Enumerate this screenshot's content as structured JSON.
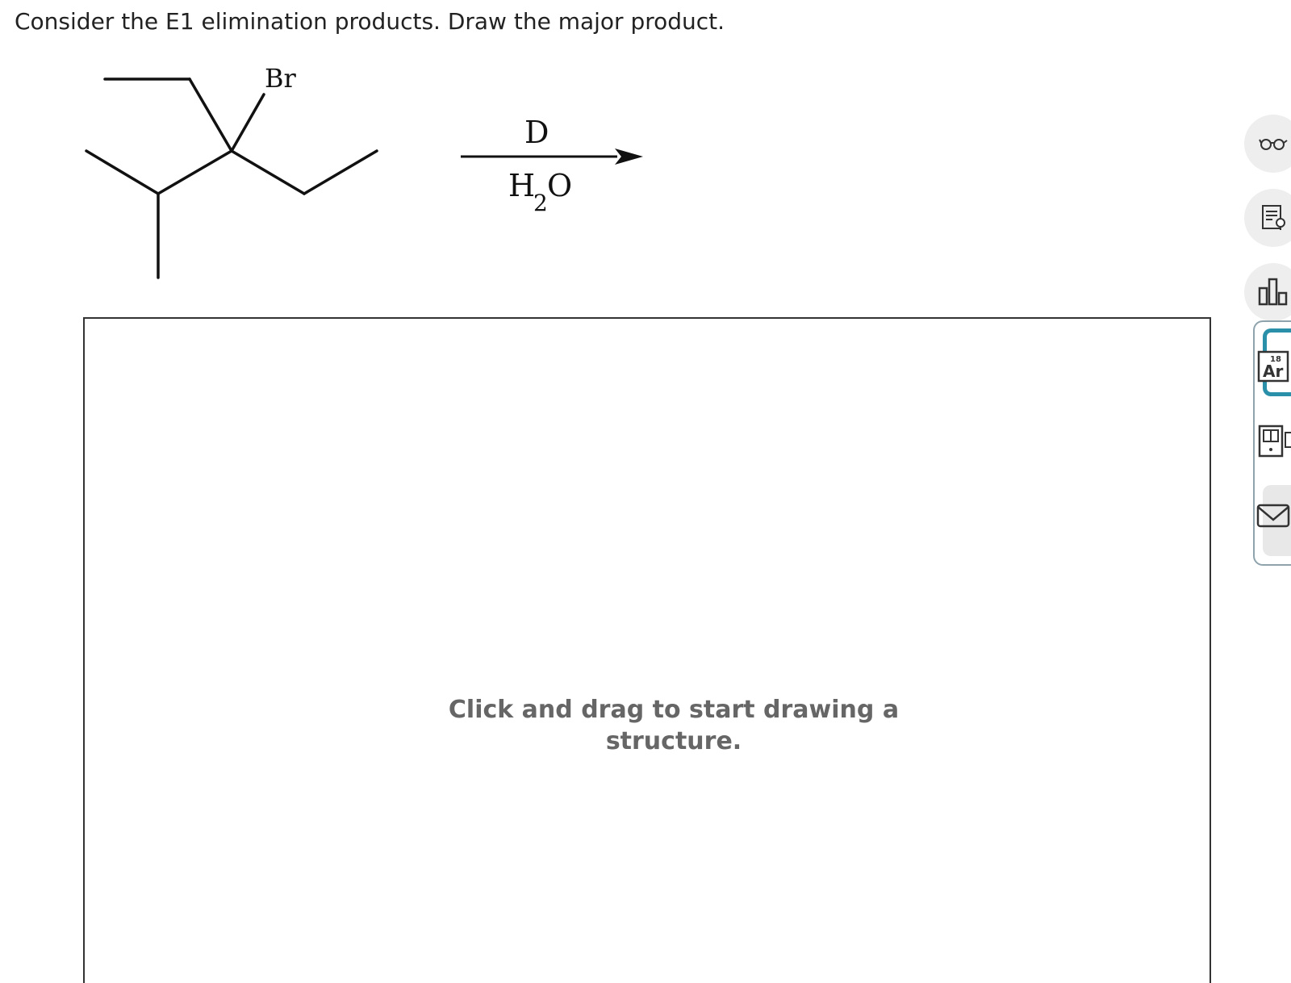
{
  "question": {
    "text": "Consider the E1 elimination products. Draw the major product."
  },
  "reaction": {
    "substituent_label": "Br",
    "condition_above": "D",
    "condition_below_h": "H",
    "condition_below_sub": "2",
    "condition_below_o": "O"
  },
  "drawing_area": {
    "hint": "Click and drag to start drawing a structure."
  },
  "element_tile": {
    "number": "18",
    "symbol": "Ar"
  },
  "toolbar": {
    "icons": [
      "glasses-icon",
      "notes-icon",
      "bar-chart-icon",
      "periodic-table-icon",
      "calculator-icon",
      "mail-icon"
    ]
  },
  "colors": {
    "accent": "#2a8fa8",
    "panel_border": "#8fa3ad",
    "hint_text": "#666666",
    "button_bg": "#eeeeee"
  }
}
